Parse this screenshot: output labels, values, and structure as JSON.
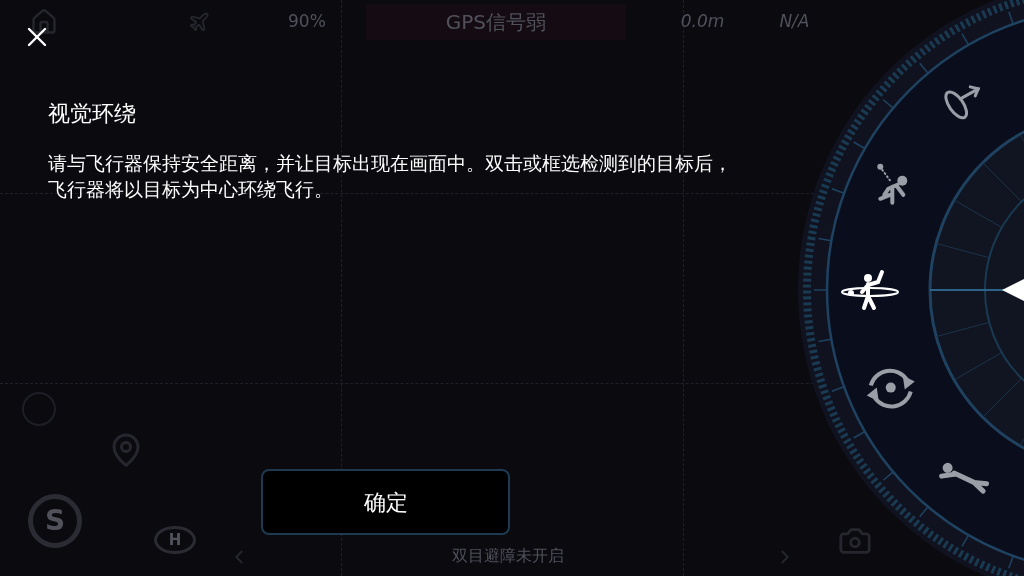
{
  "status_bar": {
    "battery": "90%",
    "gps": "GPS信号弱",
    "height": "0.0m",
    "distance": "N/A"
  },
  "left_tools": {
    "stop_label": "S",
    "home_label": "H"
  },
  "dialog": {
    "title": "视觉环绕",
    "description": "请与飞行器保持安全距离，并让目标出现在画面中。双击或框选检测到的目标后，飞行器将以目标为中心环绕飞行。",
    "confirm": "确定"
  },
  "modes": [
    {
      "kind": "launch",
      "selected": false
    },
    {
      "kind": "follow",
      "selected": false
    },
    {
      "kind": "orbit_person",
      "selected": true
    },
    {
      "kind": "orbit",
      "selected": false
    },
    {
      "kind": "lie",
      "selected": false
    }
  ],
  "bottom_notice": "双目避障未开启"
}
